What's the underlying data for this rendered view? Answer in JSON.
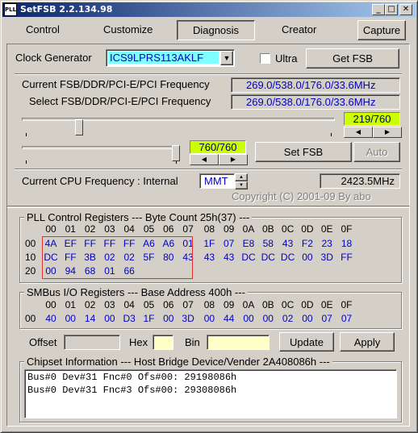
{
  "window": {
    "title": "SetFSB 2.2.134.98",
    "icon_text": "PLL"
  },
  "tabs": [
    {
      "label": "Control"
    },
    {
      "label": "Customize"
    },
    {
      "label": "Diagnosis"
    },
    {
      "label": "Creator"
    },
    {
      "label": "Capture"
    }
  ],
  "clock": {
    "label": "Clock Generator",
    "value": "ICS9LPRS113AKLF",
    "ultra_label": "Ultra",
    "ultra_checked": false,
    "get_fsb_label": "Get FSB"
  },
  "freq": {
    "current_label": "Current FSB/DDR/PCI-E/PCI Frequency",
    "current_value": "269.0/538.0/176.0/33.6MHz",
    "select_label": "Select FSB/DDR/PCI-E/PCI Frequency",
    "select_value": "269.0/538.0/176.0/33.6MHz"
  },
  "slider1": {
    "readout": "219/760",
    "position": 219,
    "max": 760
  },
  "slider2": {
    "readout": "760/760",
    "position": 760,
    "max": 760
  },
  "buttons": {
    "set_fsb": "Set FSB",
    "auto": "Auto",
    "update": "Update",
    "apply": "Apply"
  },
  "cpu": {
    "label": "Current CPU Frequency : Internal",
    "mode": "MMT",
    "value": "2423.5MHz",
    "copyright": "Copyright (C) 2001-09 By abo"
  },
  "pll": {
    "title": "PLL Control Registers  --- Byte Count 25h(37) ---",
    "headers": [
      "00",
      "01",
      "02",
      "03",
      "04",
      "05",
      "06",
      "07",
      "08",
      "09",
      "0A",
      "0B",
      "0C",
      "0D",
      "0E",
      "0F"
    ],
    "rows": [
      {
        "label": "00",
        "cells": [
          "4A",
          "EF",
          "FF",
          "FF",
          "FF",
          "A6",
          "A6",
          "01",
          "1F",
          "07",
          "E8",
          "58",
          "43",
          "F2",
          "23",
          "18"
        ]
      },
      {
        "label": "10",
        "cells": [
          "DC",
          "FF",
          "3B",
          "02",
          "02",
          "5F",
          "80",
          "43",
          "43",
          "43",
          "DC",
          "DC",
          "DC",
          "00",
          "3D",
          "FF"
        ]
      },
      {
        "label": "20",
        "cells": [
          "00",
          "94",
          "68",
          "01",
          "66"
        ]
      }
    ]
  },
  "smbus": {
    "title": "SMBus I/O Registers  --- Base Address 400h ---",
    "headers": [
      "00",
      "01",
      "02",
      "03",
      "04",
      "05",
      "06",
      "07",
      "08",
      "09",
      "0A",
      "0B",
      "0C",
      "0D",
      "0E",
      "0F"
    ],
    "rows": [
      {
        "label": "00",
        "cells": [
          "40",
          "00",
          "14",
          "00",
          "D3",
          "1F",
          "00",
          "3D",
          "00",
          "44",
          "00",
          "00",
          "02",
          "00",
          "07",
          "07"
        ]
      }
    ]
  },
  "edit": {
    "offset_label": "Offset",
    "offset_value": "",
    "hex_label": "Hex",
    "hex_value": "",
    "bin_label": "Bin",
    "bin_value": ""
  },
  "chipset": {
    "title": "Chipset Information  --- Host Bridge Device/Vender 2A408086h ---",
    "lines": [
      "Bus#0 Dev#31 Fnc#0 Ofs#00: 29198086h",
      "Bus#0 Dev#31 Fnc#3 Ofs#00: 29308086h"
    ]
  },
  "colors": {
    "titlebar": "#0a246a",
    "highlight": "#ccff00",
    "value_text": "#0000c8",
    "selection_box": "#e03030"
  }
}
